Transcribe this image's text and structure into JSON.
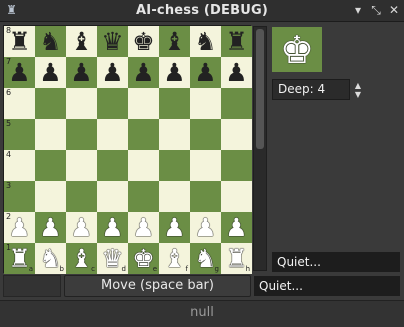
{
  "window": {
    "title": "AI-chess (DEBUG)",
    "icons": [
      "app-icon",
      "maximize-icon",
      "restore-icon",
      "close-icon"
    ]
  },
  "board": {
    "files": [
      "a",
      "b",
      "c",
      "d",
      "e",
      "f",
      "g",
      "h"
    ],
    "ranks": [
      "8",
      "7",
      "6",
      "5",
      "4",
      "3",
      "2",
      "1"
    ],
    "light_color": "#f4f4dc",
    "dark_color": "#6b8e45",
    "rows": [
      [
        "bR",
        "bN",
        "bB",
        "bQ",
        "bK",
        "bB",
        "bN",
        "bR"
      ],
      [
        "bP",
        "bP",
        "bP",
        "bP",
        "bP",
        "bP",
        "bP",
        "bP"
      ],
      [
        "",
        "",
        "",
        "",
        "",
        "",
        "",
        ""
      ],
      [
        "",
        "",
        "",
        "",
        "",
        "",
        "",
        ""
      ],
      [
        "",
        "",
        "",
        "",
        "",
        "",
        "",
        ""
      ],
      [
        "",
        "",
        "",
        "",
        "",
        "",
        "",
        ""
      ],
      [
        "wP",
        "wP",
        "wP",
        "wP",
        "wP",
        "wP",
        "wP",
        "wP"
      ],
      [
        "wR",
        "wN",
        "wB",
        "wQ",
        "wK",
        "wB",
        "wN",
        "wR"
      ]
    ]
  },
  "side_panel": {
    "current_piece": "wK",
    "depth_label": "Deep: 4",
    "quiet_top": "Quiet...",
    "quiet_bottom": "Quiet..."
  },
  "controls": {
    "move_button_label": "Move (space bar)"
  },
  "status": {
    "text": "null"
  }
}
